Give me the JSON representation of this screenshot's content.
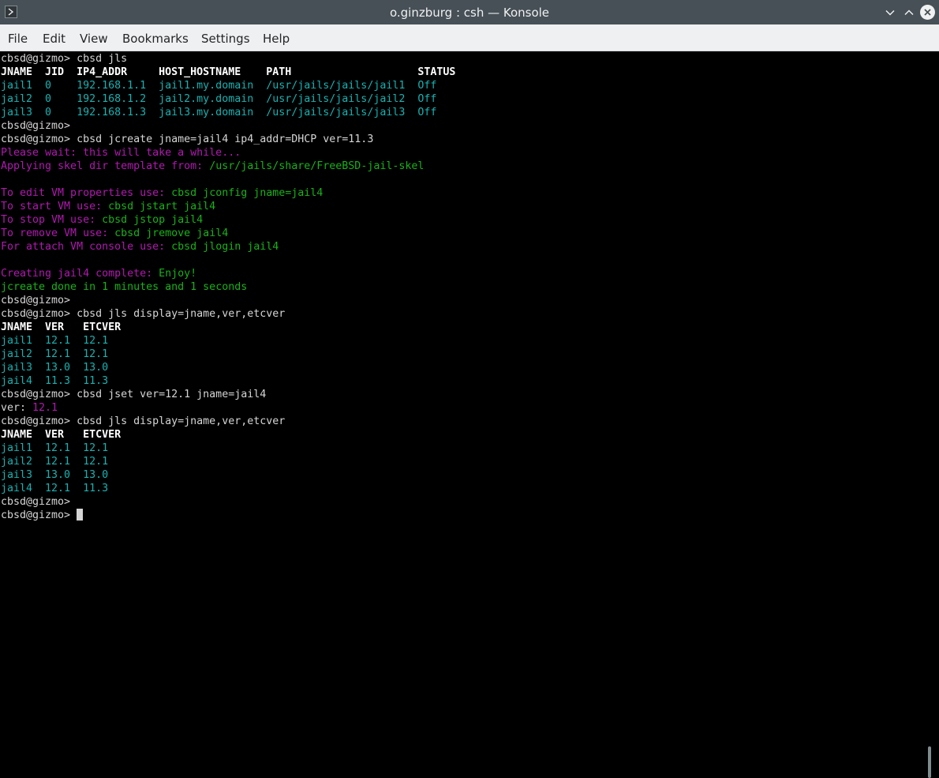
{
  "window": {
    "title": "o.ginzburg : csh — Konsole"
  },
  "menu": [
    "File",
    "Edit",
    "View",
    "Bookmarks",
    "Settings",
    "Help"
  ],
  "colors": {
    "titlebar": "#475057",
    "menubar": "#eff0f1",
    "prompt": "#d5d5d5",
    "cyan": "#18b2b2",
    "magenta": "#b218b2",
    "green": "#18b218"
  },
  "terminal": {
    "lines": [
      [
        {
          "t": "cbsd@gizmo> cbsd jls",
          "c": "pr"
        }
      ],
      [
        {
          "t": "JNAME  JID  IP4_ADDR     HOST_HOSTNAME    PATH                    STATUS",
          "c": "hd"
        }
      ],
      [
        {
          "t": "jail1  0    192.168.1.1  jail1.my.domain  /usr/jails/jails/jail1  Off",
          "c": "cy"
        }
      ],
      [
        {
          "t": "jail2  0    192.168.1.2  jail2.my.domain  /usr/jails/jails/jail2  Off",
          "c": "cy"
        }
      ],
      [
        {
          "t": "jail3  0    192.168.1.3  jail3.my.domain  /usr/jails/jails/jail3  Off",
          "c": "cy"
        }
      ],
      [
        {
          "t": "cbsd@gizmo>",
          "c": "pr"
        }
      ],
      [
        {
          "t": "cbsd@gizmo> cbsd jcreate jname=jail4 ip4_addr=DHCP ver=11.3",
          "c": "pr"
        }
      ],
      [
        {
          "t": "Please wait: this will take a while...",
          "c": "mg"
        }
      ],
      [
        {
          "t": "Applying skel dir template from: ",
          "c": "mg"
        },
        {
          "t": "/usr/jails/share/FreeBSD-jail-skel",
          "c": "gr"
        }
      ],
      [],
      [
        {
          "t": "To edit VM properties use: ",
          "c": "mg"
        },
        {
          "t": "cbsd jconfig jname=jail4",
          "c": "gr"
        }
      ],
      [
        {
          "t": "To start VM use: ",
          "c": "mg"
        },
        {
          "t": "cbsd jstart jail4",
          "c": "gr"
        }
      ],
      [
        {
          "t": "To stop VM use: ",
          "c": "mg"
        },
        {
          "t": "cbsd jstop jail4",
          "c": "gr"
        }
      ],
      [
        {
          "t": "To remove VM use: ",
          "c": "mg"
        },
        {
          "t": "cbsd jremove jail4",
          "c": "gr"
        }
      ],
      [
        {
          "t": "For attach VM console use: ",
          "c": "mg"
        },
        {
          "t": "cbsd jlogin jail4",
          "c": "gr"
        }
      ],
      [],
      [
        {
          "t": "Creating jail4 complete: ",
          "c": "mg"
        },
        {
          "t": "Enjoy!",
          "c": "gr"
        }
      ],
      [
        {
          "t": "jcreate done ",
          "c": "gr"
        },
        {
          "t": "in 1 minutes and 1 seconds",
          "c": "gr"
        }
      ],
      [
        {
          "t": "cbsd@gizmo>",
          "c": "pr"
        }
      ],
      [
        {
          "t": "cbsd@gizmo> cbsd jls display=jname,ver,etcver",
          "c": "pr"
        }
      ],
      [
        {
          "t": "JNAME  VER   ETCVER",
          "c": "hd"
        }
      ],
      [
        {
          "t": "jail1  12.1  12.1",
          "c": "cy"
        }
      ],
      [
        {
          "t": "jail2  12.1  12.1",
          "c": "cy"
        }
      ],
      [
        {
          "t": "jail3  13.0  13.0",
          "c": "cy"
        }
      ],
      [
        {
          "t": "jail4  11.3  11.3",
          "c": "cy"
        }
      ],
      [
        {
          "t": "cbsd@gizmo> cbsd jset ver=12.1 jname=jail4",
          "c": "pr"
        }
      ],
      [
        {
          "t": "ver: ",
          "c": "pr"
        },
        {
          "t": "12.1",
          "c": "mg"
        }
      ],
      [
        {
          "t": "cbsd@gizmo> cbsd jls display=jname,ver,etcver",
          "c": "pr"
        }
      ],
      [
        {
          "t": "JNAME  VER   ETCVER",
          "c": "hd"
        }
      ],
      [
        {
          "t": "jail1  12.1  12.1",
          "c": "cy"
        }
      ],
      [
        {
          "t": "jail2  12.1  12.1",
          "c": "cy"
        }
      ],
      [
        {
          "t": "jail3  13.0  13.0",
          "c": "cy"
        }
      ],
      [
        {
          "t": "jail4  12.1  11.3",
          "c": "cy"
        }
      ],
      [
        {
          "t": "cbsd@gizmo>",
          "c": "pr"
        }
      ],
      [
        {
          "t": "cbsd@gizmo>",
          "c": "pr",
          "cursor": true
        }
      ]
    ]
  }
}
